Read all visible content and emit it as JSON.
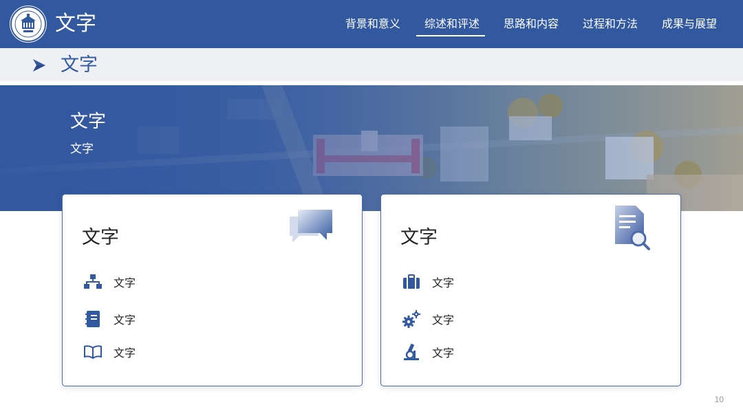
{
  "header": {
    "brand": "文字",
    "nav": [
      "背景和意义",
      "综述和评述",
      "思路和内容",
      "过程和方法",
      "成果与展望"
    ],
    "active_index": 1
  },
  "subbar": {
    "title": "文字"
  },
  "banner": {
    "title": "文字",
    "subtitle": "文字"
  },
  "cards": [
    {
      "title": "文字",
      "deco_icon": "chat-bubbles-icon",
      "items": [
        {
          "icon": "org-chart-icon",
          "label": "文字"
        },
        {
          "icon": "notebook-icon",
          "label": "文字"
        },
        {
          "icon": "open-book-icon",
          "label": "文字"
        }
      ]
    },
    {
      "title": "文字",
      "deco_icon": "document-search-icon",
      "items": [
        {
          "icon": "briefcase-icon",
          "label": "文字"
        },
        {
          "icon": "gears-icon",
          "label": "文字"
        },
        {
          "icon": "microscope-icon",
          "label": "文字"
        }
      ]
    }
  ],
  "colors": {
    "primary": "#3258a0",
    "subbar": "#eef0f4",
    "text": "#222222"
  },
  "page_number": "10"
}
